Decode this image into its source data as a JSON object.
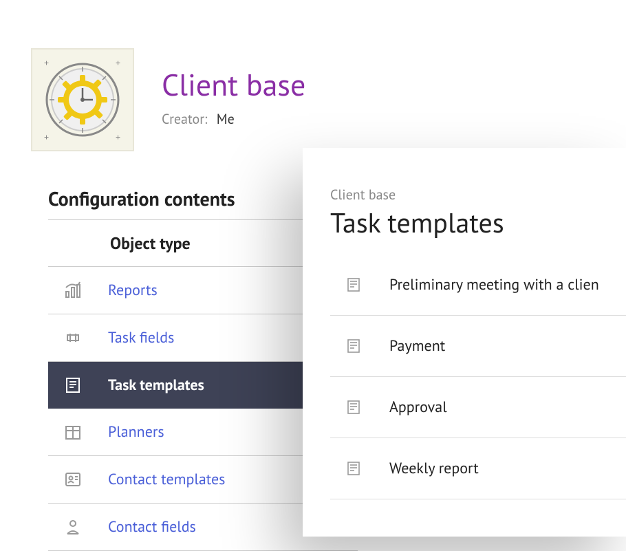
{
  "header": {
    "title": "Client base",
    "creator_label": "Creator:",
    "creator_value": "Me"
  },
  "config": {
    "section_title": "Configuration contents",
    "column_header": "Object type",
    "items": [
      {
        "icon": "reports",
        "label": "Reports",
        "active": false
      },
      {
        "icon": "fields",
        "label": "Task fields",
        "active": false
      },
      {
        "icon": "template",
        "label": "Task templates",
        "active": true
      },
      {
        "icon": "planner",
        "label": "Planners",
        "active": false
      },
      {
        "icon": "contact-template",
        "label": "Contact templates",
        "active": false
      },
      {
        "icon": "contact-field",
        "label": "Contact fields",
        "active": false
      }
    ]
  },
  "overlay": {
    "breadcrumb": "Client base",
    "title": "Task templates",
    "templates": [
      {
        "label": "Preliminary meeting with a clien"
      },
      {
        "label": "Payment"
      },
      {
        "label": "Approval"
      },
      {
        "label": "Weekly report"
      }
    ]
  },
  "colors": {
    "accent_purple": "#8a2ea5",
    "link_blue": "#4a5fd8",
    "active_bg": "#3e4256"
  }
}
